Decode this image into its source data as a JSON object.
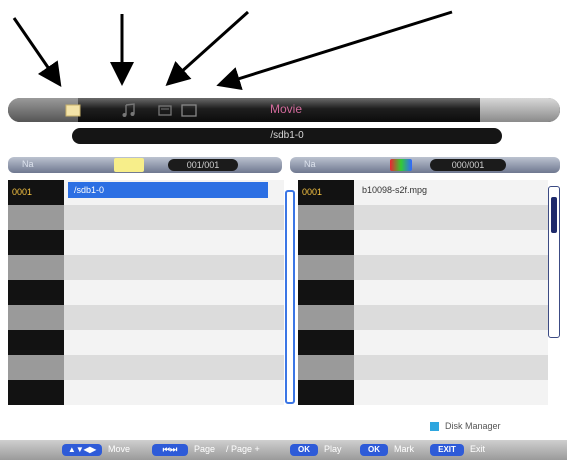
{
  "media_bar": {
    "title": "Movie",
    "icons": [
      "folder-icon",
      "music-note-icon",
      "photo-icon",
      "movie-icon"
    ]
  },
  "path": "/sdb1-0",
  "left_panel": {
    "header_label": "Na",
    "counter": "001/001",
    "rows": [
      {
        "number": "0001",
        "name": "/sdb1-0",
        "selected": true
      },
      {
        "number": "",
        "name": ""
      },
      {
        "number": "",
        "name": ""
      },
      {
        "number": "",
        "name": ""
      },
      {
        "number": "",
        "name": ""
      },
      {
        "number": "",
        "name": ""
      },
      {
        "number": "",
        "name": ""
      },
      {
        "number": "",
        "name": ""
      },
      {
        "number": "",
        "name": ""
      }
    ]
  },
  "right_panel": {
    "header_label": "Na",
    "counter": "000/001",
    "rows": [
      {
        "number": "0001",
        "name": "b10098-s2f.mpg"
      },
      {
        "number": "",
        "name": ""
      },
      {
        "number": "",
        "name": ""
      },
      {
        "number": "",
        "name": ""
      },
      {
        "number": "",
        "name": ""
      },
      {
        "number": "",
        "name": ""
      },
      {
        "number": "",
        "name": ""
      },
      {
        "number": "",
        "name": ""
      },
      {
        "number": "",
        "name": ""
      }
    ]
  },
  "legend": {
    "label": "Disk Manager",
    "color": "#2ea6df"
  },
  "help_bar": {
    "move_label": "Move",
    "page_label": "Page",
    "page_sub_label": "/ Page +",
    "play_key": "OK",
    "play_label": "Play",
    "mark_key": "OK",
    "mark_label": "Mark",
    "exit_key": "EXIT",
    "exit_label": "Exit"
  },
  "colors": {
    "accent_blue": "#2c6fe3",
    "title_pink": "#d36a9c",
    "number_yellow": "#f5c242"
  }
}
